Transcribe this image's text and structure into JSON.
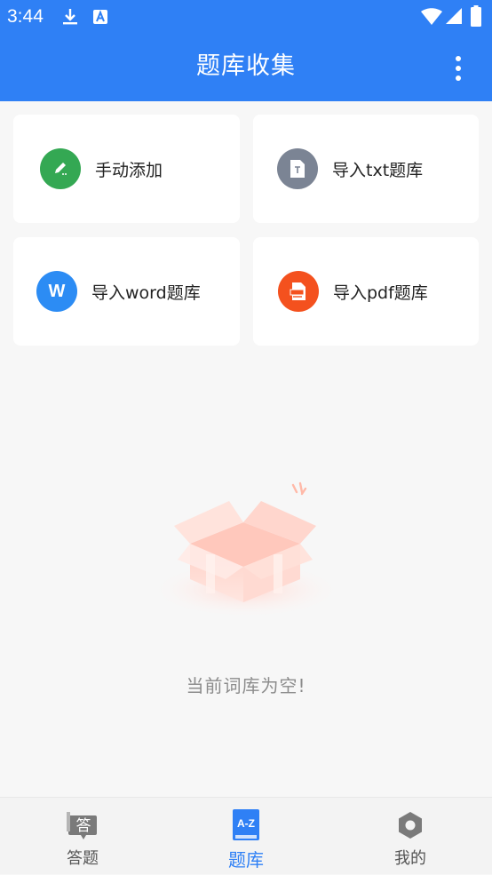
{
  "status_bar": {
    "time": "3:44"
  },
  "app_bar": {
    "title": "题库收集"
  },
  "actions": [
    {
      "label": "手动添加",
      "icon": "pencil-icon",
      "color": "#34a853"
    },
    {
      "label": "导入txt题库",
      "icon": "txt-file-icon",
      "color": "#7b8494"
    },
    {
      "label": "导入word题库",
      "icon": "word-icon",
      "icon_text": "W",
      "color": "#2c8cf4"
    },
    {
      "label": "导入pdf题库",
      "icon": "pdf-icon",
      "color": "#f4511e"
    }
  ],
  "empty_state": {
    "message": "当前词库为空!"
  },
  "bottom_nav": {
    "items": [
      {
        "label": "答题",
        "icon": "answer-icon",
        "icon_text": "答",
        "active": false
      },
      {
        "label": "题库",
        "icon": "az-book-icon",
        "icon_text": "A-Z",
        "active": true
      },
      {
        "label": "我的",
        "icon": "hexagon-icon",
        "active": false
      }
    ]
  },
  "colors": {
    "primary": "#2f80f5",
    "background": "#f7f7f7"
  }
}
